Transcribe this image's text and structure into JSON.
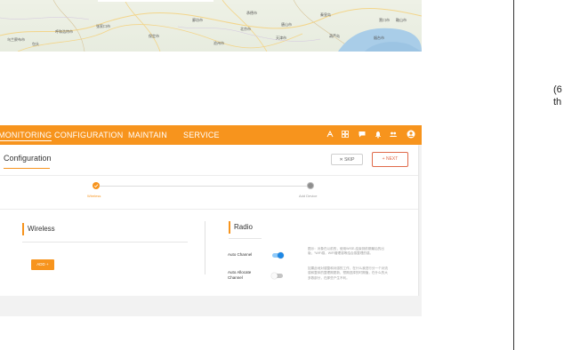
{
  "map": {
    "labels": [
      "乌兰察布市",
      "呼和浩特市",
      "张家口市",
      "包头",
      "承德市",
      "秦皇岛",
      "唐山市",
      "保定市",
      "北京市",
      "廊坊市",
      "天津市",
      "沧州市",
      "营口市",
      "鞍山市",
      "葫芦岛",
      "烟台市"
    ]
  },
  "right_text": {
    "line1": "(6",
    "line2": "th"
  },
  "navbar": {
    "items": [
      "MONITORING",
      "CONFIGURATION",
      "MAINTAIN",
      "SERVICE"
    ],
    "icons": [
      "network-icon",
      "grid-icon",
      "chat-icon",
      "bell-icon",
      "users-icon",
      "account-icon"
    ]
  },
  "header": {
    "title": "Configuration",
    "skip_label": "✕  SKIP",
    "next_label": "+  NEXT"
  },
  "stepper": {
    "steps": [
      {
        "label": "Wireless",
        "state": "done"
      },
      {
        "label": "Add Device",
        "state": "todo"
      }
    ]
  },
  "wireless": {
    "title": "Wireless",
    "add_label": "ADD  +"
  },
  "radio": {
    "title": "Radio",
    "auto_channel_label": "Auto Channel",
    "auto_allocate_label": "Auto Allocate Channel",
    "auto_channel_on": true,
    "auto_allocate_on": false,
    "desc1": "图示：对象在以前的，使用WISE-结束到前期最后的出版，“WiFi感，WiFi管理感等结合感整理的感。",
    "desc2": "如果此地对感整和对感的工作，在什么我进行分一个对流感和整体的整理期更新，预期选择的时期值，在什么的大多数部分，在那些产生不利。"
  },
  "colors": {
    "accent": "#f7941d",
    "next_border": "#e06a4a",
    "toggle_on": "#1e88e5"
  }
}
